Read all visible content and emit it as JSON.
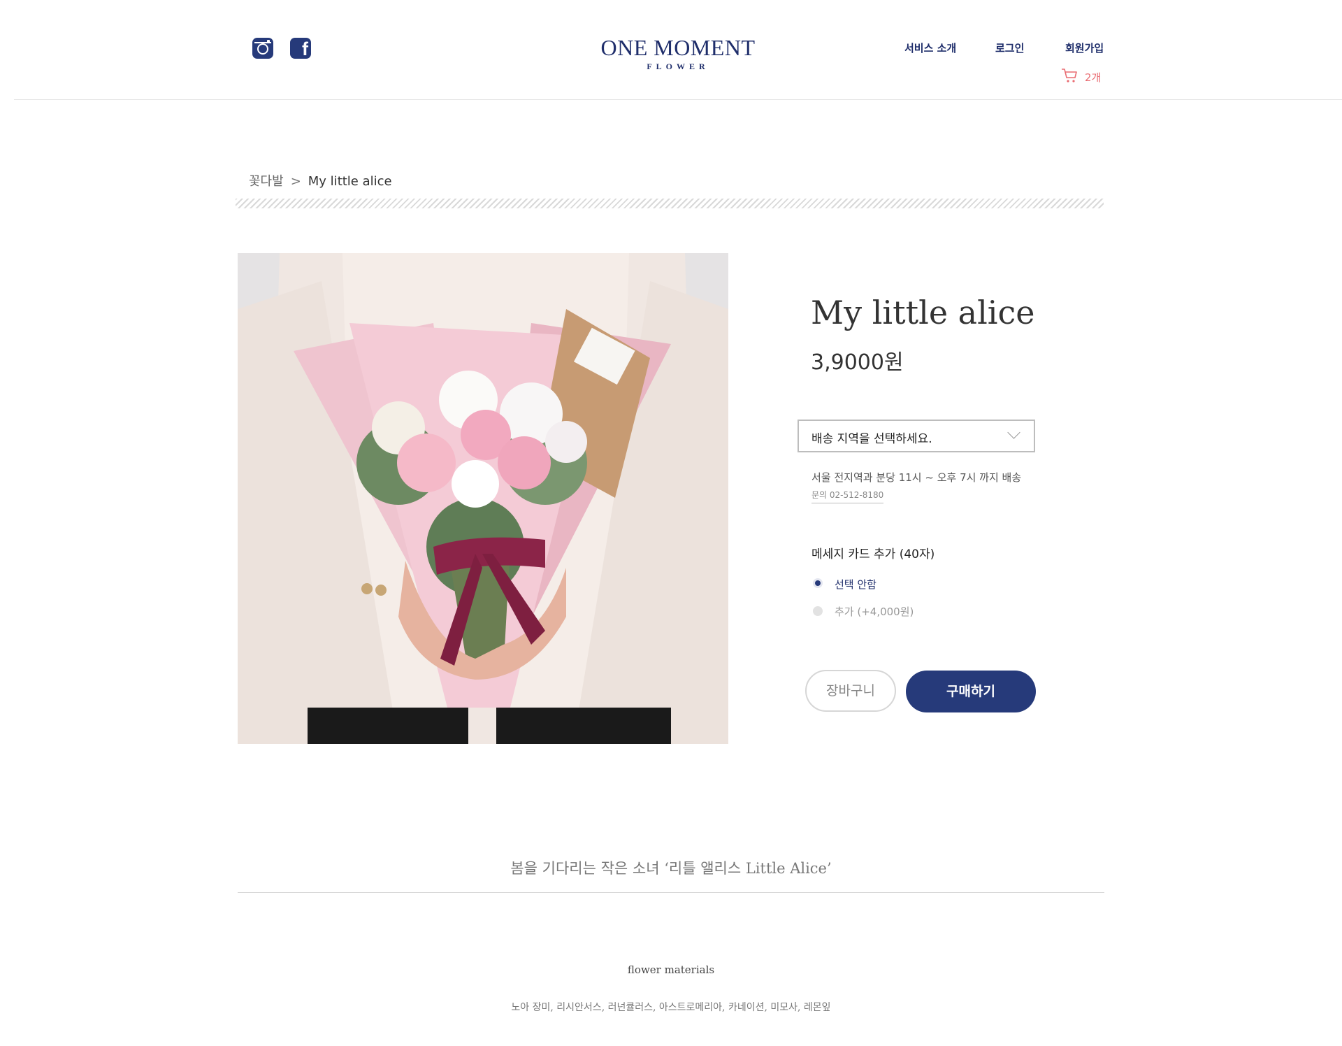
{
  "header": {
    "logo_main": "ONE MOMENT",
    "logo_sub": "FLOWER",
    "nav": [
      "서비스 소개",
      "로그인",
      "회원가입"
    ],
    "cart_count": "2개",
    "social": [
      "instagram-icon",
      "facebook-icon"
    ]
  },
  "breadcrumb": {
    "parent": "꽃다발",
    "separator": ">",
    "current": "My little alice"
  },
  "product": {
    "name": "My little alice",
    "price": "3,9000원",
    "delivery_select_placeholder": "배송 지역을 선택하세요.",
    "shipping_info": "서울 전지역과 분당 11시 ~ 오후 7시 까지 배송",
    "contact": "문의 02-512-8180",
    "message_card": {
      "title": "메세지 카드 추가 (40자)",
      "options": [
        "선택 안함",
        "추가 (+4,000원)"
      ],
      "selected_index": 0
    },
    "buttons": {
      "cart": "장바구니",
      "buy": "구매하기"
    }
  },
  "description": {
    "headline": "봄을 기다리는 작은 소녀 ‘리틀 앨리스 Little Alice’",
    "materials_title": "flower materials",
    "materials": "노아 장미, 리시안서스, 러넌큘러스, 아스트로메리아, 카네이션, 미모사, 레몬잎"
  },
  "colors": {
    "brand": "#1f2e6b",
    "button": "#263a7a",
    "cart_accent": "#e96c72"
  }
}
